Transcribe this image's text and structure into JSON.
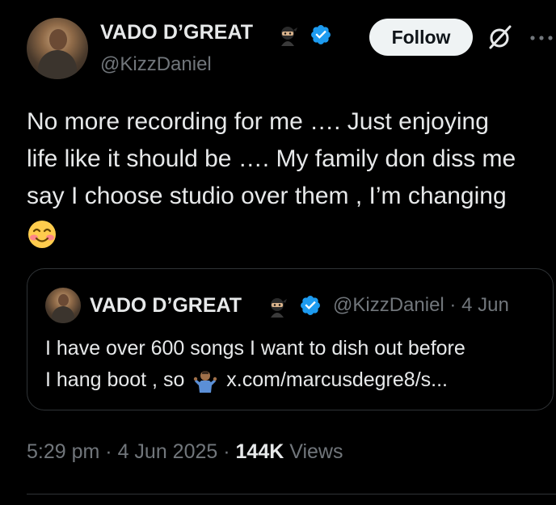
{
  "author": {
    "display_name": "VADO D’GREAT",
    "handle": "@KizzDaniel",
    "avatar_icon": "profile-photo",
    "badge_emoji_icon": "ninja-emoji-icon",
    "verified_icon": "verified-badge-icon"
  },
  "actions": {
    "follow_label": "Follow",
    "grok_icon": "grok-icon",
    "more_icon": "more-options-icon"
  },
  "tweet": {
    "lines": [
      "No more recording for me …. Just enjoying",
      "life like it should be …. My family don diss me",
      "say I choose  studio over them , I’m changing"
    ],
    "trailing_emoji": "smiling-face-with-smiling-eyes-emoji"
  },
  "quote": {
    "display_name": "VADO D’GREAT",
    "handle": "@KizzDaniel",
    "separator": "·",
    "date": "4 Jun",
    "line1": "I have over 600 songs I want to dish out before",
    "line2_prefix": "I hang boot , so",
    "line2_emoji": "person-shrugging-emoji",
    "link": "x.com/marcusdegre8/s..."
  },
  "footer": {
    "time": "5:29 pm",
    "sep1": "·",
    "date": "4 Jun 2025",
    "sep2": "·",
    "views_count": "144K",
    "views_label": "Views"
  },
  "colors": {
    "background": "#000000",
    "primary_text": "#e7e9ea",
    "secondary_text": "#71767b",
    "verified_blue": "#1d9bf0",
    "border": "#2f3336"
  }
}
